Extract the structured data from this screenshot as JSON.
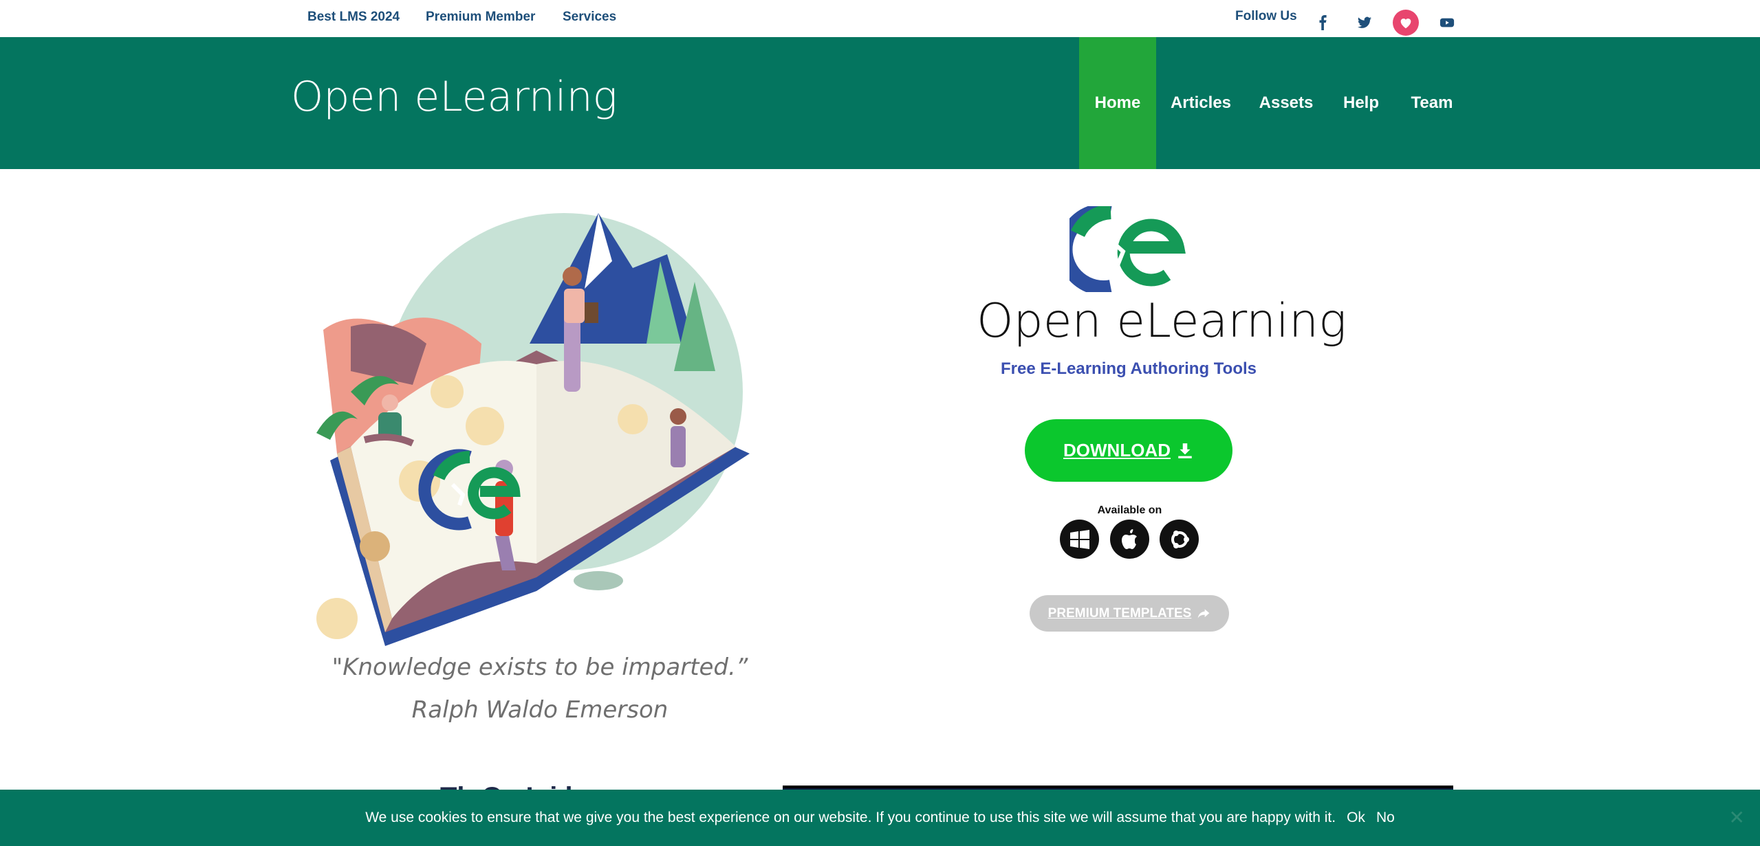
{
  "topbar": {
    "links": [
      "Best LMS 2024",
      "Premium Member",
      "Services"
    ],
    "follow_label": "Follow Us",
    "social": [
      "facebook-icon",
      "twitter-icon",
      "heart-icon",
      "youtube-icon"
    ]
  },
  "header": {
    "site_title": "Open eLearning",
    "nav": [
      "Home",
      "Articles",
      "Assets",
      "Help",
      "Team"
    ],
    "active_nav": "Home"
  },
  "hero": {
    "quote": "\"Knowledge exists to be imparted.” Ralph Waldo Emerson",
    "brand_name": "Open eLearning",
    "tagline": "Free E-Learning Authoring Tools",
    "download_label": "DOWNLOAD",
    "available_label": "Available on",
    "platforms": [
      "windows-icon",
      "apple-icon",
      "ubuntu-icon"
    ],
    "premium_label": "PREMIUM TEMPLATES"
  },
  "section": {
    "title_fragment": "Th   O    eL     i    l"
  },
  "cookie": {
    "message": "We use cookies to ensure that we give you the best experience on our website. If you continue to use this site we will assume that you are happy with it.",
    "ok_label": "Ok",
    "no_label": "No",
    "close_glyph": "✕"
  },
  "colors": {
    "header_bg": "#04755f",
    "active_nav": "#22a63a",
    "download_btn": "#0bc72d",
    "tagline": "#3b4fb0",
    "premium_btn": "#c9c9c9",
    "link": "#1e4f7a"
  }
}
